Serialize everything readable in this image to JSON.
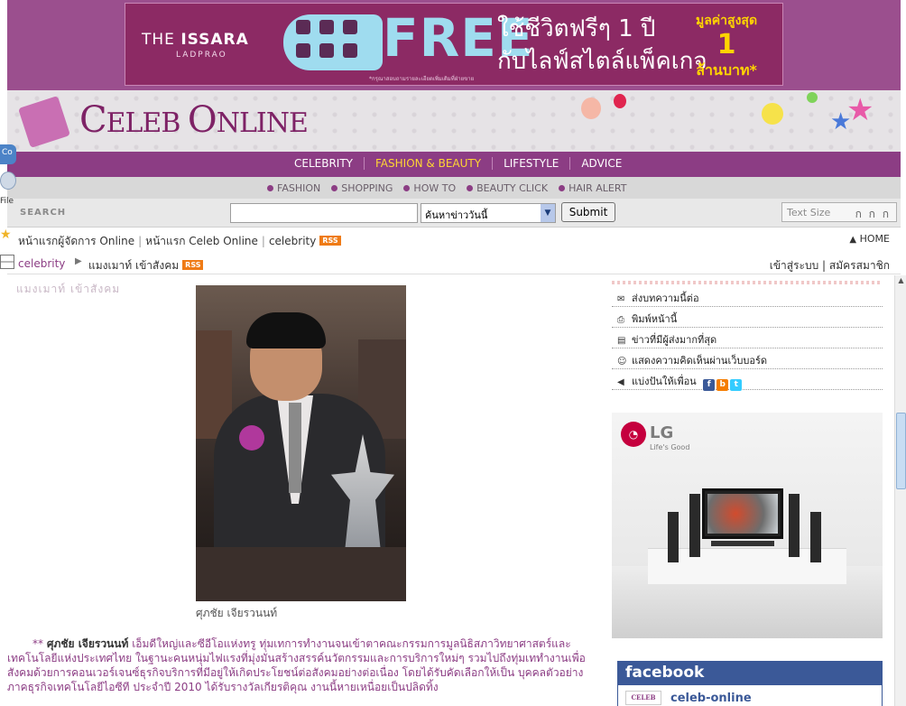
{
  "banner": {
    "brand_a": "THE",
    "brand_b": "ISSARA",
    "brand_sub": "LADPRAO",
    "free_word": "FREE",
    "thai_line1": "ใช้ชีวิตฟรีๆ 1 ปี",
    "thai_line2": "กับไลฟ์สไตล์แพ็คเกจ",
    "promo_line1": "มูลค่าสูงสุด",
    "promo_line2": "1",
    "promo_line3": "ล้านบาท*",
    "fine_print": "*กรุณาสอบถามรายละเอียดเพิ่มเติมที่ฝ่ายขาย"
  },
  "logo": {
    "text_c": "C",
    "text_a": "ELEB ",
    "text_o": "O",
    "text_b": "NLINE"
  },
  "nav": {
    "items": [
      "CELEBRITY",
      "FASHION & BEAUTY",
      "LIFESTYLE",
      "ADVICE"
    ],
    "active": "FASHION & BEAUTY"
  },
  "subnav": {
    "items": [
      "FASHION",
      "SHOPPING",
      "HOW TO",
      "BEAUTY CLICK",
      "HAIR ALERT"
    ]
  },
  "search": {
    "label": "SEARCH",
    "input_value": "",
    "select_value": "ค้นหาข่าววันนี้",
    "submit_label": "Submit",
    "textsize_label": "Text Size",
    "textsize_icons": "ก ก ก"
  },
  "breadcrumb1": {
    "link1": "หน้าแรกผู้จัดการ Online",
    "link2": "หน้าแรก Celeb Online",
    "link3": "celebrity",
    "rss": "RSS",
    "home": "HOME"
  },
  "breadcrumb2": {
    "category": "celebrity",
    "title": "แมงเมาท์ เข้าสังคม",
    "rss": "RSS",
    "login": "เข้าสู่ระบบ",
    "register": "สมัครสมาชิก"
  },
  "left_fragments": {
    "tab_text": "Co",
    "file_text": "File"
  },
  "article": {
    "faded_heading": "แมงเมาท์ เข้าสังคม",
    "caption": "ศุภชัย เจียรวนนท์",
    "body_stars": "**",
    "body_name": "ศุภชัย เจียรวนนท์",
    "body_text": " เอ็มดีใหญ่และซีอีโอแห่งทรู ทุ่มเทการทำงานจนเข้าตาคณะกรรมการมูลนิธิสภาวิทยาศาสตร์และเทคโนโลยีแห่งประเทศไทย ในฐานะคนหนุ่มไฟแรงที่มุ่งมั่นสร้างสรรค์นวัตกรรมและการบริการใหม่ๆ รวมไปถึงทุ่มเททำงานเพื่อสังคมด้วยการคอนเวอร์เจนซ์ธุรกิจบริการที่มีอยู่ให้เกิดประโยชน์ต่อสังคมอย่างต่อเนื่อง โดยได้รับคัดเลือกให้เป็น บุคคลตัวอย่าง ภาคธุรกิจเทคโนโลยีไอซีที ประจำปี 2010 ได้รับรางวัลเกียรติคุณ งานนี้หายเหนื่อยเป็นปลิดทิ้ง"
  },
  "sidebar": {
    "tools": [
      {
        "icon": "✉",
        "label": "ส่งบทความนี้ต่อ"
      },
      {
        "icon": "⎙",
        "label": "พิมพ์หน้านี้"
      },
      {
        "icon": "▤",
        "label": "ข่าวที่มีผู้ส่งมากที่สุด"
      },
      {
        "icon": "☺",
        "label": "แสดงความคิดเห็นผ่านเว็บบอร์ด"
      },
      {
        "icon": "◀",
        "label": "แบ่งปันให้เพื่อน"
      }
    ],
    "lg_logo": "LG",
    "lg_tagline": "Life's Good",
    "facebook_title": "facebook",
    "facebook_page_logo": "CELEB",
    "facebook_page": "celeb-online"
  },
  "colors": {
    "brand_purple": "#8c3d84",
    "nav_active": "#ffd633",
    "rss_orange": "#ef7b16",
    "facebook_blue": "#3b5998"
  }
}
